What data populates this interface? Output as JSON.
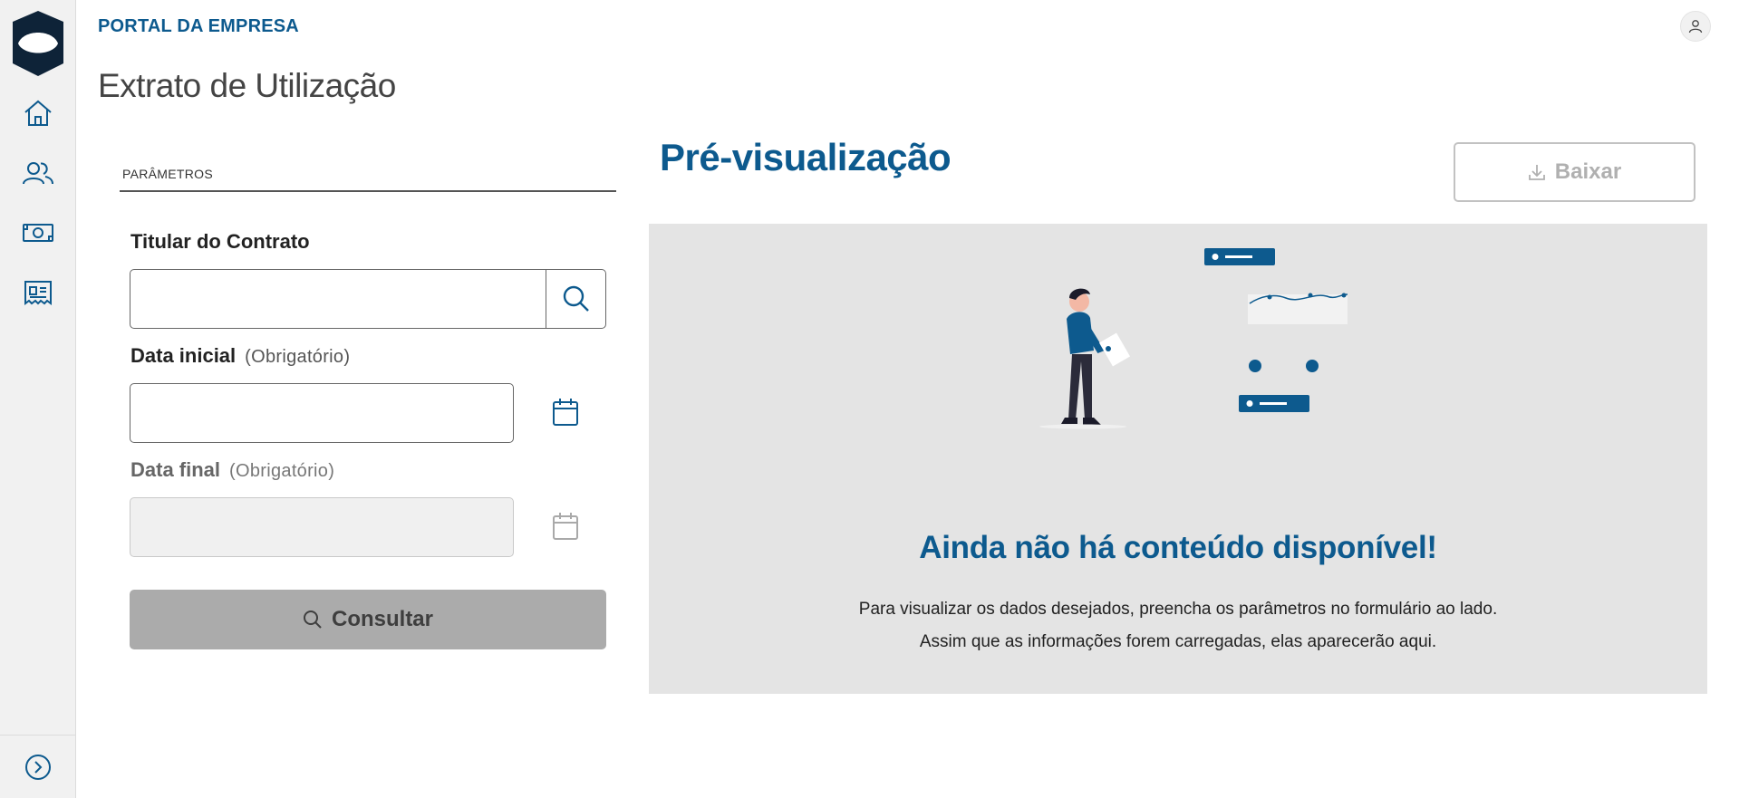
{
  "header": {
    "brand": "PORTAL DA EMPRESA",
    "page_title": "Extrato de Utilização"
  },
  "sidebar": {
    "items": [
      {
        "icon": "home-icon"
      },
      {
        "icon": "users-icon"
      },
      {
        "icon": "money-icon"
      },
      {
        "icon": "statement-icon"
      }
    ],
    "expand_icon": "chevron-right-circle-icon"
  },
  "form": {
    "section_label": "PARÂMETROS",
    "titular": {
      "label": "Titular do Contrato",
      "value": ""
    },
    "data_inicial": {
      "label": "Data inicial",
      "required": "(Obrigatório)",
      "value": ""
    },
    "data_final": {
      "label": "Data final",
      "required": "(Obrigatório)",
      "value": ""
    },
    "submit_label": "Consultar"
  },
  "preview": {
    "title": "Pré-visualização",
    "download_label": "Baixar",
    "empty_title": "Ainda não há conteúdo disponível!",
    "empty_text": "Para visualizar os dados desejados, preencha os parâmetros no formulário ao lado. Assim que as informações forem carregadas, elas aparecerão aqui."
  },
  "colors": {
    "primary": "#0d5a8e",
    "disabled_button": "#ababab",
    "panel_bg": "#e4e4e4"
  }
}
